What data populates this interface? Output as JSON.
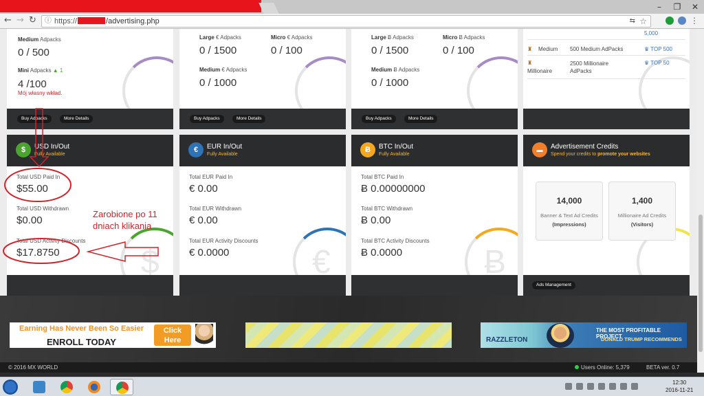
{
  "browser": {
    "url_scheme": "https://",
    "url_path": "/advertising.php",
    "window_controls": [
      "–",
      "❐",
      "✕"
    ],
    "nav": {
      "back": "←",
      "forward": "→",
      "reload": "C"
    }
  },
  "top_cards": [
    {
      "items": [
        {
          "label_bold": "Medium",
          "label": " Adpacks",
          "value": "0 / 500"
        },
        {
          "label_bold": "Mini",
          "label": " Adpacks",
          "badge": "▲ 1",
          "value": "4 /100",
          "note": "Mój własny wkład."
        }
      ],
      "buttons": [
        "Buy Adpacks",
        "More Details"
      ]
    },
    {
      "items": [
        {
          "label_bold": "Large",
          "label": " € Adpacks",
          "value": "0 / 1500"
        },
        {
          "label_bold": "Micro",
          "label": " € Adpacks",
          "value": "0 / 100"
        },
        {
          "label_bold": "Medium",
          "label": " € Adpacks",
          "value": "0 / 1000"
        }
      ],
      "buttons": [
        "Buy Adpacks",
        "More Details"
      ]
    },
    {
      "items": [
        {
          "label_bold": "Large",
          "label": " Ƀ Adpacks",
          "value": "0 / 1500"
        },
        {
          "label_bold": "Micro",
          "label": " Ƀ Adpacks",
          "value": "0 / 100"
        },
        {
          "label_bold": "Medium",
          "label": " Ƀ Adpacks",
          "value": "0 / 1000"
        }
      ],
      "buttons": [
        "Buy Adpacks",
        "More Details"
      ]
    }
  ],
  "stats_card": {
    "top_value": "5,000",
    "rows": [
      {
        "rank": "Medium",
        "desc": "500 Medium AdPacks",
        "top": "TOP 500"
      },
      {
        "rank": "Millionaire",
        "desc": "2500 Millionaire AdPacks",
        "top": "TOP 50"
      }
    ]
  },
  "money_cards": [
    {
      "icon": "$",
      "title": "USD In/Out",
      "subtitle": "Fully Available",
      "rows": [
        {
          "label": "Total USD Paid In",
          "value": "$55.00"
        },
        {
          "label": "Total USD Withdrawn",
          "value": "$0.00"
        },
        {
          "label": "Total USD Activity Discounts",
          "value": "$17.8750"
        }
      ]
    },
    {
      "icon": "€",
      "title": "EUR In/Out",
      "subtitle": "Fully Available",
      "rows": [
        {
          "label": "Total EUR Paid In",
          "value": "€ 0.00"
        },
        {
          "label": "Total EUR Withdrawn",
          "value": "€ 0.00"
        },
        {
          "label": "Total EUR Activity Discounts",
          "value": "€ 0.0000"
        }
      ]
    },
    {
      "icon": "Ƀ",
      "title": "BTC In/Out",
      "subtitle": "Fully Available",
      "rows": [
        {
          "label": "Total BTC Paid In",
          "value": "Ƀ 0.00000000"
        },
        {
          "label": "Total BTC Withdrawn",
          "value": "Ƀ 0.00"
        },
        {
          "label": "Total BTC Activity Discounts",
          "value": "Ƀ 0.0000"
        }
      ]
    }
  ],
  "ad_credits": {
    "title": "Advertisement Credits",
    "subtitle_pre": "Spend your credits to ",
    "subtitle_bold": "promote your websites",
    "boxes": [
      {
        "num": "14,000",
        "desc": "Banner & Text Ad Credits",
        "unit": "(Impressions)"
      },
      {
        "num": "1,400",
        "desc": "Millionaire Ad Credits",
        "unit": "(Visitors)"
      }
    ],
    "button": "Ads Management"
  },
  "annotation": {
    "line1": "Zarobione po 11",
    "line2": "dniach klikania"
  },
  "banners": {
    "enroll": {
      "line1": "Earning Has Never Been So Easier",
      "line2": "ENROLL TODAY",
      "click1": "Click",
      "click2": "Here"
    },
    "trump": {
      "brand": "RAZZLETON",
      "line1": "THE MOST PROFITABLE PROJECT",
      "line2": "DONALD TRUMP RECOMMENDS"
    }
  },
  "footer": {
    "copyright": "© 2016 MX WORLD",
    "online": "Users Online: 5,379",
    "beta": "BETA ver. 0.7"
  },
  "taskbar": {
    "time": "12:30",
    "date": "2016-11-21"
  },
  "colors": {
    "usd": "#49a52d",
    "eur": "#2f73b7",
    "btc": "#f5a81c",
    "ads": "#f07e2b",
    "annotation": "#d2232a"
  }
}
